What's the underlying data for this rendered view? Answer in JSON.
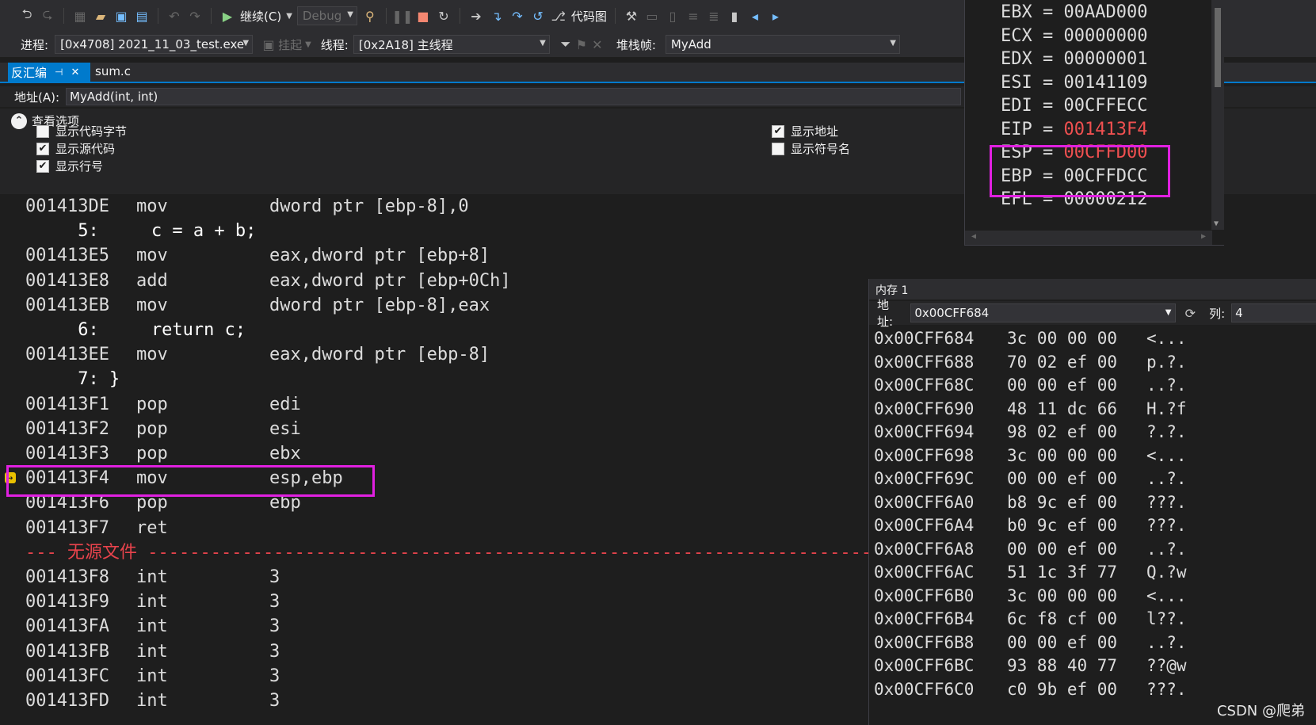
{
  "toolbar": {
    "continue_label": "继续(C)",
    "config_value": "Debug",
    "codemap_label": "代码图"
  },
  "debug_bar": {
    "process_label": "进程:",
    "process_value": "[0x4708] 2021_11_03_test.exe",
    "suspend_label": "挂起",
    "thread_label": "线程:",
    "thread_value": "[0x2A18] 主线程",
    "stackframe_label": "堆栈帧:",
    "stackframe_value": "MyAdd"
  },
  "tabs": {
    "active": "反汇编",
    "active_pin": "⊣",
    "active_close": "✕",
    "other": "sum.c"
  },
  "address_bar": {
    "label": "地址(A):",
    "value": "MyAdd(int, int)"
  },
  "view_options": {
    "title": "查看选项",
    "show_code_bytes": "显示代码字节",
    "show_source": "显示源代码",
    "show_line_numbers": "显示行号",
    "show_address": "显示地址",
    "show_symbol_names": "显示符号名",
    "checked": {
      "code_bytes": false,
      "source": true,
      "line_numbers": true,
      "address": true,
      "symbol_names": false
    }
  },
  "disassembly": [
    {
      "kind": "asm",
      "addr": "001413DE",
      "mn": "mov",
      "op": "dword ptr [ebp-8],0"
    },
    {
      "kind": "src",
      "text": "     5:     c = a + b;"
    },
    {
      "kind": "asm",
      "addr": "001413E5",
      "mn": "mov",
      "op": "eax,dword ptr [ebp+8]"
    },
    {
      "kind": "asm",
      "addr": "001413E8",
      "mn": "add",
      "op": "eax,dword ptr [ebp+0Ch]"
    },
    {
      "kind": "asm",
      "addr": "001413EB",
      "mn": "mov",
      "op": "dword ptr [ebp-8],eax"
    },
    {
      "kind": "src",
      "text": "     6:     return c;"
    },
    {
      "kind": "asm",
      "addr": "001413EE",
      "mn": "mov",
      "op": "eax,dword ptr [ebp-8]"
    },
    {
      "kind": "src",
      "text": "     7: }"
    },
    {
      "kind": "asm",
      "addr": "001413F1",
      "mn": "pop",
      "op": "edi"
    },
    {
      "kind": "asm",
      "addr": "001413F2",
      "mn": "pop",
      "op": "esi"
    },
    {
      "kind": "asm",
      "addr": "001413F3",
      "mn": "pop",
      "op": "ebx"
    },
    {
      "kind": "asm",
      "addr": "001413F4",
      "mn": "mov",
      "op": "esp,ebp",
      "current": true
    },
    {
      "kind": "asm",
      "addr": "001413F6",
      "mn": "pop",
      "op": "ebp"
    },
    {
      "kind": "asm",
      "addr": "001413F7",
      "mn": "ret",
      "op": ""
    },
    {
      "kind": "nosrc",
      "prefix": "--- ",
      "text": "无源文件",
      "dashes": " -----------------------------------------------------------------------"
    },
    {
      "kind": "asm",
      "addr": "001413F8",
      "mn": "int",
      "op": "3"
    },
    {
      "kind": "asm",
      "addr": "001413F9",
      "mn": "int",
      "op": "3"
    },
    {
      "kind": "asm",
      "addr": "001413FA",
      "mn": "int",
      "op": "3"
    },
    {
      "kind": "asm",
      "addr": "001413FB",
      "mn": "int",
      "op": "3"
    },
    {
      "kind": "asm",
      "addr": "001413FC",
      "mn": "int",
      "op": "3"
    },
    {
      "kind": "asm",
      "addr": "001413FD",
      "mn": "int",
      "op": "3"
    }
  ],
  "registers": [
    {
      "name": "EBX",
      "value": "00AAD000",
      "changed": false
    },
    {
      "name": "ECX",
      "value": "00000000",
      "changed": false
    },
    {
      "name": "EDX",
      "value": "00000001",
      "changed": false
    },
    {
      "name": "ESI",
      "value": "00141109",
      "changed": false
    },
    {
      "name": "EDI",
      "value": "00CFFECC",
      "changed": false
    },
    {
      "name": "EIP",
      "value": "001413F4",
      "changed": true
    },
    {
      "name": "ESP",
      "value": "00CFFD00",
      "changed": true
    },
    {
      "name": "EBP",
      "value": "00CFFDCC",
      "changed": false
    },
    {
      "name": "EFL",
      "value": "00000212",
      "changed": false
    }
  ],
  "memory": {
    "title": "内存 1",
    "address_label": "地址:",
    "address_value": "0x00CFF684",
    "columns_label": "列:",
    "columns_value": "4",
    "rows": [
      {
        "addr": "0x00CFF684",
        "bytes": "3c 00 00 00",
        "chars": "<..."
      },
      {
        "addr": "0x00CFF688",
        "bytes": "70 02 ef 00",
        "chars": "p.?."
      },
      {
        "addr": "0x00CFF68C",
        "bytes": "00 00 ef 00",
        "chars": "..?."
      },
      {
        "addr": "0x00CFF690",
        "bytes": "48 11 dc 66",
        "chars": "H.?f"
      },
      {
        "addr": "0x00CFF694",
        "bytes": "98 02 ef 00",
        "chars": "?.?."
      },
      {
        "addr": "0x00CFF698",
        "bytes": "3c 00 00 00",
        "chars": "<..."
      },
      {
        "addr": "0x00CFF69C",
        "bytes": "00 00 ef 00",
        "chars": "..?."
      },
      {
        "addr": "0x00CFF6A0",
        "bytes": "b8 9c ef 00",
        "chars": "???."
      },
      {
        "addr": "0x00CFF6A4",
        "bytes": "b0 9c ef 00",
        "chars": "???."
      },
      {
        "addr": "0x00CFF6A8",
        "bytes": "00 00 ef 00",
        "chars": "..?."
      },
      {
        "addr": "0x00CFF6AC",
        "bytes": "51 1c 3f 77",
        "chars": "Q.?w"
      },
      {
        "addr": "0x00CFF6B0",
        "bytes": "3c 00 00 00",
        "chars": "<..."
      },
      {
        "addr": "0x00CFF6B4",
        "bytes": "6c f8 cf 00",
        "chars": "l??."
      },
      {
        "addr": "0x00CFF6B8",
        "bytes": "00 00 ef 00",
        "chars": "..?."
      },
      {
        "addr": "0x00CFF6BC",
        "bytes": "93 88 40 77",
        "chars": "??@w"
      },
      {
        "addr": "0x00CFF6C0",
        "bytes": "c0 9b ef 00",
        "chars": "???."
      }
    ]
  },
  "watermark": "CSDN @爬弟",
  "colors": {
    "accent": "#007acc",
    "highlight": "#e020e0",
    "changed": "#f05050",
    "nosource": "#e8434c"
  }
}
